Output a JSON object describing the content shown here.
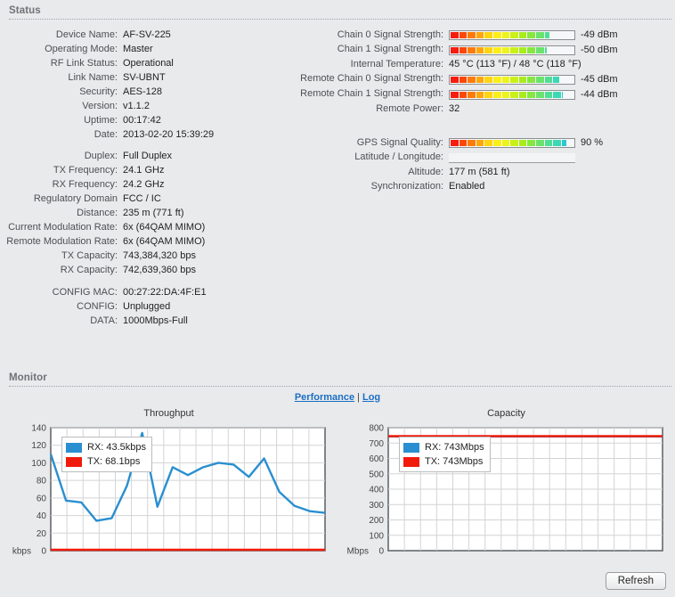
{
  "status": {
    "header": "Status",
    "left_rows": [
      {
        "label": "Device Name:",
        "value": "AF-SV-225"
      },
      {
        "label": "Operating Mode:",
        "value": "Master"
      },
      {
        "label": "RF Link Status:",
        "value": "Operational"
      },
      {
        "label": "Link Name:",
        "value": "SV-UBNT"
      },
      {
        "label": "Security:",
        "value": "AES-128"
      },
      {
        "label": "Version:",
        "value": "v1.1.2"
      },
      {
        "label": "Uptime:",
        "value": "00:17:42"
      },
      {
        "label": "Date:",
        "value": "2013-02-20 15:39:29"
      },
      {
        "label": "Duplex:",
        "value": "Full Duplex",
        "gap": true
      },
      {
        "label": "TX Frequency:",
        "value": "24.1 GHz"
      },
      {
        "label": "RX Frequency:",
        "value": "24.2 GHz"
      },
      {
        "label": "Regulatory Domain",
        "value": "FCC / IC"
      },
      {
        "label": "Distance:",
        "value": "235 m (771 ft)"
      },
      {
        "label": "Current Modulation Rate:",
        "value": "6x (64QAM MIMO)",
        "wrap": true
      },
      {
        "label": "Remote Modulation Rate:",
        "value": "6x (64QAM MIMO)",
        "wrap": true
      },
      {
        "label": "TX Capacity:",
        "value": "743,384,320 bps"
      },
      {
        "label": "RX Capacity:",
        "value": "742,639,360 bps"
      },
      {
        "label": "CONFIG MAC:",
        "value": "00:27:22:DA:4F:E1",
        "gap": true
      },
      {
        "label": "CONFIG:",
        "value": "Unplugged"
      },
      {
        "label": "DATA:",
        "value": "1000Mbps-Full"
      }
    ],
    "right_rows": [
      {
        "label": "Chain 0 Signal Strength:",
        "type": "bar",
        "percent": 79,
        "value": "-49 dBm"
      },
      {
        "label": "Chain 1 Signal Strength:",
        "type": "bar",
        "percent": 77,
        "value": "-50 dBm"
      },
      {
        "label": "Internal Temperature:",
        "type": "text",
        "value": "45 °C (113 °F) / 48 °C (118 °F)"
      },
      {
        "label": "Remote Chain 0 Signal Strength:",
        "type": "bar",
        "percent": 87,
        "value": "-45 dBm"
      },
      {
        "label": "Remote Chain 1 Signal Strength:",
        "type": "bar",
        "percent": 90,
        "value": "-44 dBm"
      },
      {
        "label": "Remote Power:",
        "type": "text",
        "value": "32"
      }
    ],
    "gps_rows": [
      {
        "label": "GPS Signal Quality:",
        "type": "bar",
        "percent": 93,
        "value": "90 %"
      },
      {
        "label": "Latitude / Longitude:",
        "type": "blank",
        "value": ""
      },
      {
        "label": "Altitude:",
        "type": "text",
        "value": "177 m (581 ft)"
      },
      {
        "label": "Synchronization:",
        "type": "text",
        "value": "Enabled"
      }
    ]
  },
  "monitor": {
    "header": "Monitor",
    "tabs": {
      "performance": "Performance",
      "separator": "|",
      "log": "Log"
    },
    "refresh_label": "Refresh"
  },
  "chart_data": [
    {
      "type": "line",
      "title": "Throughput",
      "ylabel": "kbps",
      "xlabel": "",
      "ylim": [
        0,
        140
      ],
      "yticks": [
        0,
        20,
        40,
        60,
        80,
        100,
        120,
        140
      ],
      "grid": true,
      "legend_position": "top-left",
      "series": [
        {
          "name": "RX: 43.5kbps",
          "color": "#2a8fd0",
          "values": [
            110,
            57,
            55,
            34,
            37,
            74,
            134,
            50,
            95,
            86,
            95,
            100,
            98,
            84,
            105,
            67,
            51,
            45,
            43
          ]
        },
        {
          "name": "TX: 68.1bps",
          "color": "#f11b0c",
          "values": [
            1,
            1,
            1,
            1,
            1,
            1,
            1,
            1,
            1,
            1,
            1,
            1,
            1,
            1,
            1,
            1,
            1,
            1,
            1
          ]
        }
      ]
    },
    {
      "type": "line",
      "title": "Capacity",
      "ylabel": "Mbps",
      "xlabel": "",
      "ylim": [
        0,
        800
      ],
      "yticks": [
        0,
        100,
        200,
        300,
        400,
        500,
        600,
        700,
        800
      ],
      "grid": true,
      "legend_position": "top-left",
      "series": [
        {
          "name": "RX: 743Mbps",
          "color": "#2a8fd0",
          "values": [
            743,
            743,
            743,
            743,
            743,
            743,
            743,
            743,
            743,
            743,
            743,
            743,
            743,
            743,
            743,
            743,
            743,
            743,
            743
          ]
        },
        {
          "name": "TX: 743Mbps",
          "color": "#f11b0c",
          "values": [
            745,
            745,
            745,
            745,
            745,
            745,
            745,
            745,
            745,
            745,
            745,
            745,
            745,
            745,
            745,
            745,
            745,
            745,
            745
          ]
        }
      ]
    }
  ],
  "colors": {
    "link": "#1c6fc4",
    "rx": "#2a8fd0",
    "tx": "#f11b0c",
    "panel_bg": "#e9eaec",
    "header_text": "#6e7277"
  }
}
